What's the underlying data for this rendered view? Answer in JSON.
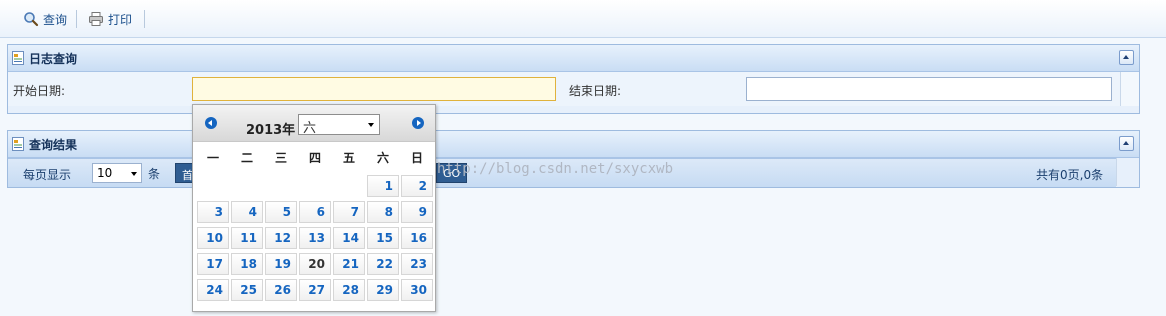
{
  "toolbar": {
    "query_label": "查询",
    "print_label": "打印"
  },
  "log_panel": {
    "title": "日志查询",
    "start_label": "开始日期:",
    "start_value": "",
    "end_label": "结束日期:",
    "end_value": ""
  },
  "results_panel": {
    "title": "查询结果",
    "per_page_label": "每页显示",
    "per_page_value": "10",
    "unit_label": "条",
    "first_btn": "首",
    "go_btn": "GO",
    "summary": "共有0页,0条"
  },
  "watermark": "http://blog.csdn.net/sxycxwb",
  "calendar": {
    "year_label": "2013年",
    "month_value": "六",
    "weekdays": [
      "一",
      "二",
      "三",
      "四",
      "五",
      "六",
      "日"
    ],
    "today": 20,
    "days": [
      1,
      2,
      3,
      4,
      5,
      6,
      7,
      8,
      9,
      10,
      11,
      12,
      13,
      14,
      15,
      16,
      17,
      18,
      19,
      20,
      21,
      22,
      23,
      24,
      25,
      26,
      27,
      28,
      29,
      30
    ]
  },
  "colors": {
    "accent": "#1565c0",
    "panel_header": "#c9ddf4",
    "active_field_border": "#e0b23c"
  }
}
